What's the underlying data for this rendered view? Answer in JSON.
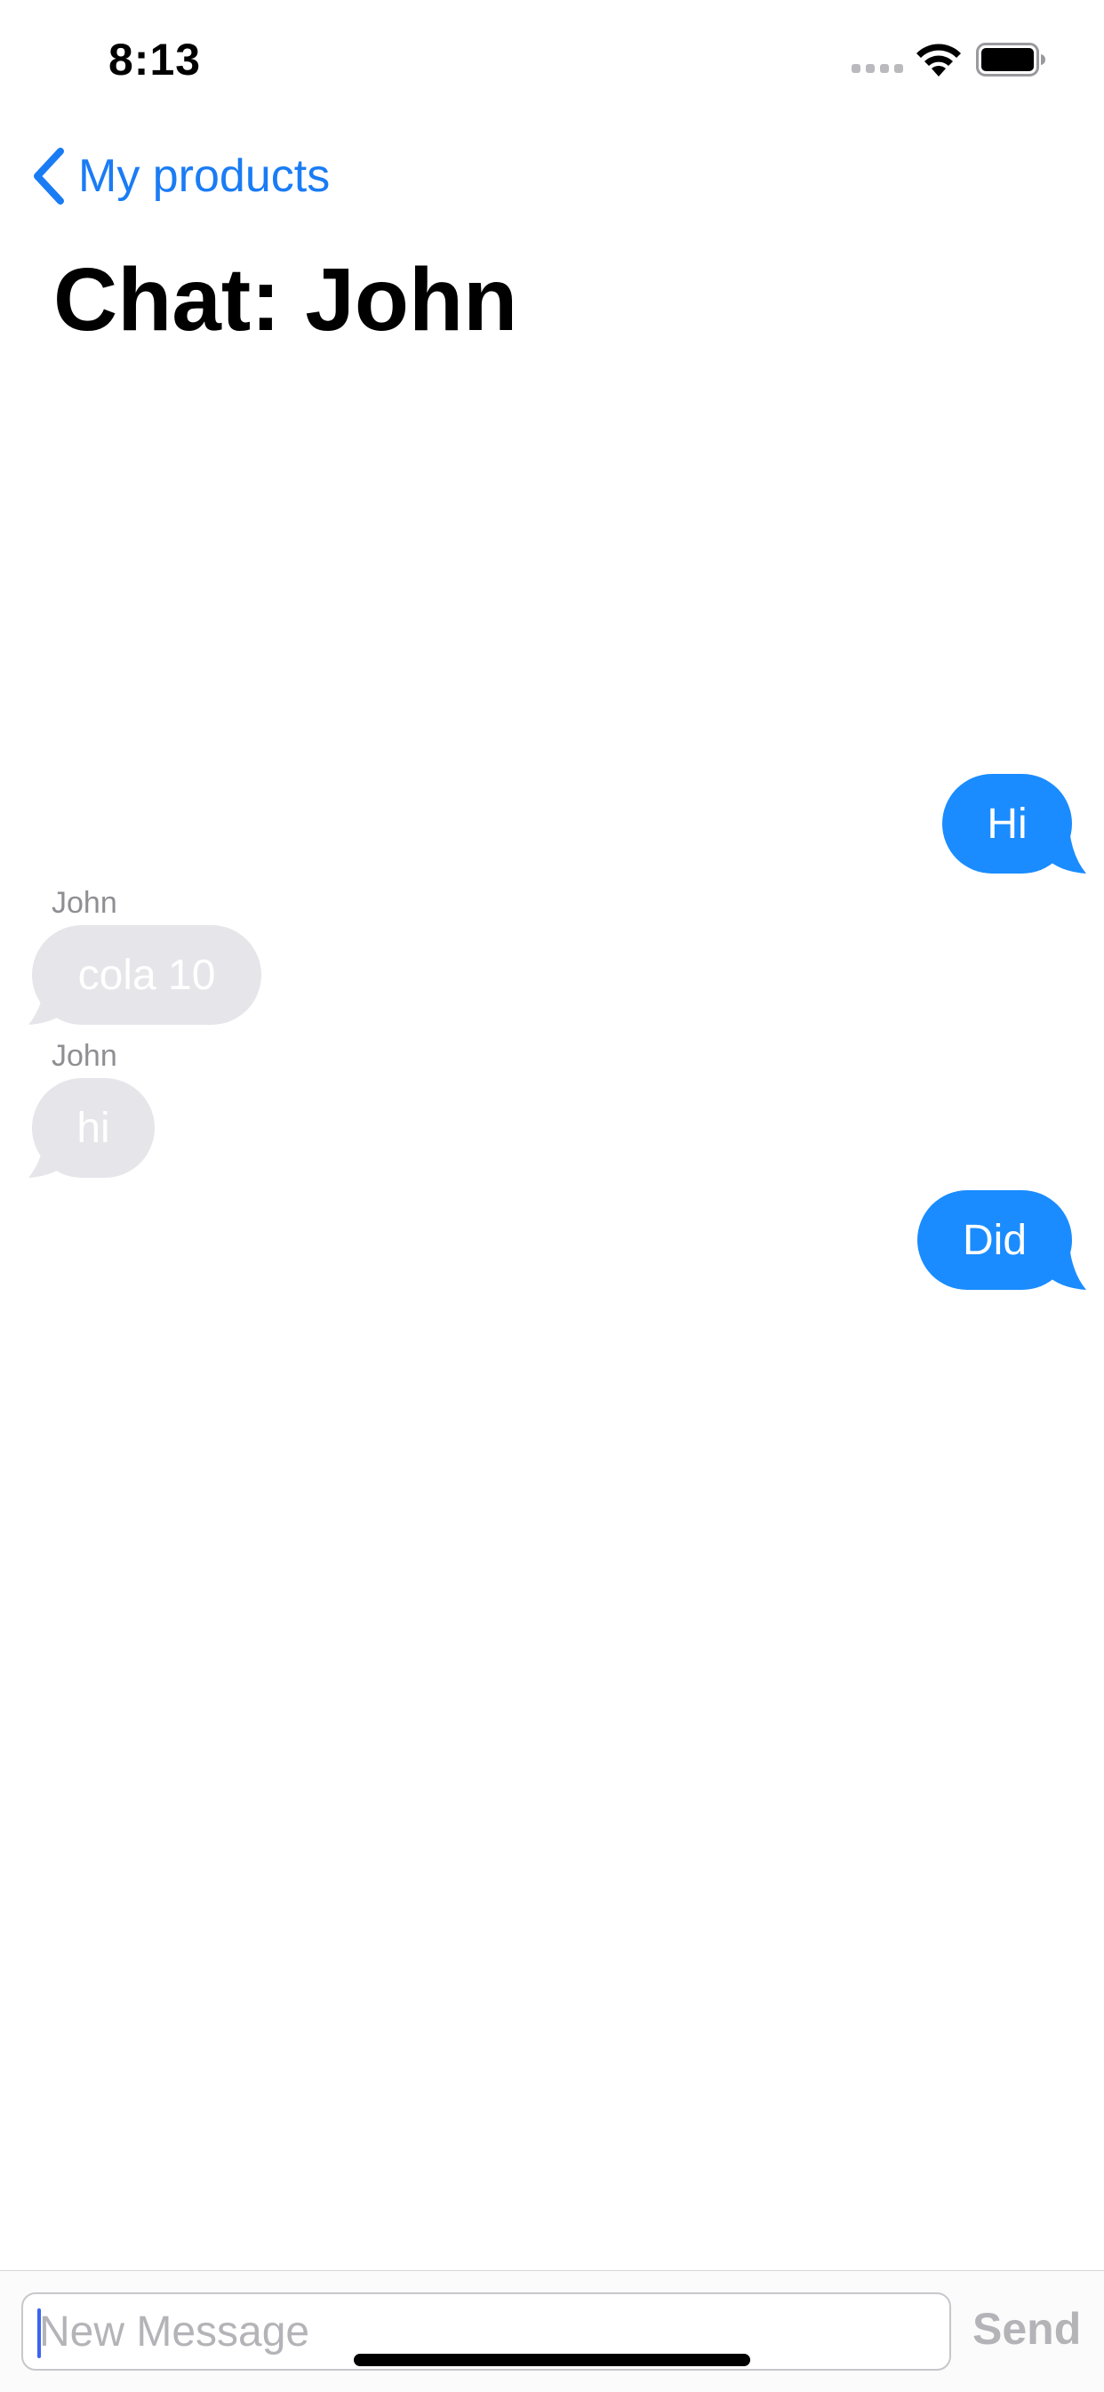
{
  "status_bar": {
    "time": "8:13",
    "signal_icon": "cellular-signal-icon",
    "wifi_icon": "wifi-icon",
    "battery_icon": "battery-icon"
  },
  "nav": {
    "back_label": "My products",
    "back_icon": "chevron-left-icon",
    "title": "Chat: John"
  },
  "messages": [
    {
      "direction": "outgoing",
      "sender": "",
      "text": "Hi"
    },
    {
      "direction": "incoming",
      "sender": "John",
      "text": "cola 10"
    },
    {
      "direction": "incoming",
      "sender": "John",
      "text": "hi"
    },
    {
      "direction": "outgoing",
      "sender": "",
      "text": "Did"
    }
  ],
  "composer": {
    "value": "",
    "placeholder": "New Message",
    "send_label": "Send"
  },
  "colors": {
    "accent": "#1a7cf5",
    "outgoing_bubble": "#1a8cff",
    "incoming_bubble": "#e5e5ea",
    "muted_text": "#8e8e93"
  }
}
